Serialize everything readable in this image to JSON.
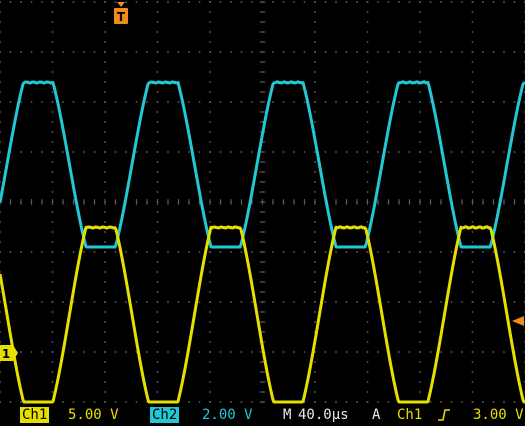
{
  "colors": {
    "background": "#000000",
    "grid": "#5a5a5a",
    "ch1": "#e6e000",
    "ch2": "#22c8d2",
    "trigger": "#f08c1e"
  },
  "markers": {
    "trigger_position_label": "T",
    "ch1_ground_label": "1",
    "trigger_level_icon": "left-arrow-icon"
  },
  "status": {
    "ch1_label": "Ch1",
    "ch1_scale": "5.00 V",
    "ch2_label": "Ch2",
    "ch2_scale": "2.00 V",
    "timebase_mode": "M",
    "timebase": "40.0µs",
    "acquire_mode": "A",
    "trigger_source": "Ch1",
    "trigger_slope_icon": "rising-edge-icon",
    "trigger_level": "3.00 V"
  },
  "chart_data": {
    "type": "line",
    "title": "",
    "xlabel": "",
    "ylabel": "",
    "grid": true,
    "divisions": {
      "x": 10,
      "y": 8
    },
    "series": [
      {
        "name": "Ch1",
        "color": "#e6e000",
        "shape": "clipped-sine",
        "cycles_visible": 4.2,
        "low_div": -4.0,
        "high_div": -0.5
      },
      {
        "name": "Ch2",
        "color": "#22c8d2",
        "shape": "clipped-sine",
        "cycles_visible": 4.2,
        "low_div": -0.9,
        "high_div": 2.4
      }
    ]
  }
}
